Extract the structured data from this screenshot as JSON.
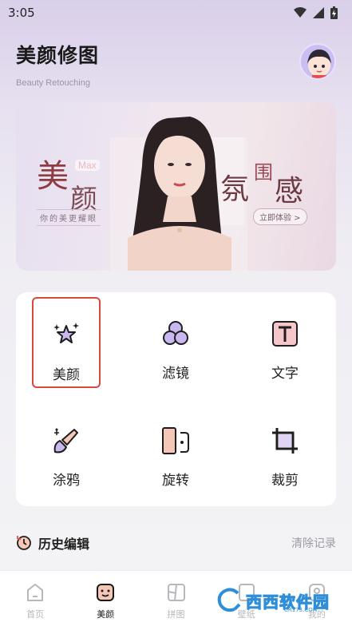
{
  "status": {
    "time": "3:05"
  },
  "header": {
    "title": "美颜修图",
    "subtitle": "Beauty Retouching"
  },
  "banner": {
    "left_char1": "美",
    "left_char2": "颜",
    "max_tag": "Max",
    "tagline": "你的美更耀眼",
    "right_char1": "氛",
    "right_char2": "围",
    "right_char3": "感",
    "cta": "立即体验 >"
  },
  "tools": [
    {
      "label": "美颜",
      "icon": "sparkle-stars-icon",
      "selected": true
    },
    {
      "label": "滤镜",
      "icon": "filter-circles-icon",
      "selected": false
    },
    {
      "label": "文字",
      "icon": "text-t-icon",
      "selected": false
    },
    {
      "label": "涂鸦",
      "icon": "brush-icon",
      "selected": false
    },
    {
      "label": "旋转",
      "icon": "rotate-icon",
      "selected": false
    },
    {
      "label": "裁剪",
      "icon": "crop-icon",
      "selected": false
    }
  ],
  "history": {
    "title": "历史编辑",
    "clear": "清除记录"
  },
  "tabs": [
    {
      "label": "首页",
      "icon": "home-icon",
      "active": false
    },
    {
      "label": "美颜",
      "icon": "face-icon",
      "active": true
    },
    {
      "label": "拼图",
      "icon": "collage-icon",
      "active": false
    },
    {
      "label": "壁纸",
      "icon": "wallpaper-icon",
      "active": false
    },
    {
      "label": "我的",
      "icon": "profile-icon",
      "active": false
    }
  ],
  "watermark": {
    "text": "西西软件园",
    "url": "CR173.COM"
  },
  "colors": {
    "accent_red": "#d9473d",
    "icon_dark": "#1e1e1e",
    "icon_fill": "#c9b8f0",
    "icon_pink": "#f6c7b6"
  }
}
